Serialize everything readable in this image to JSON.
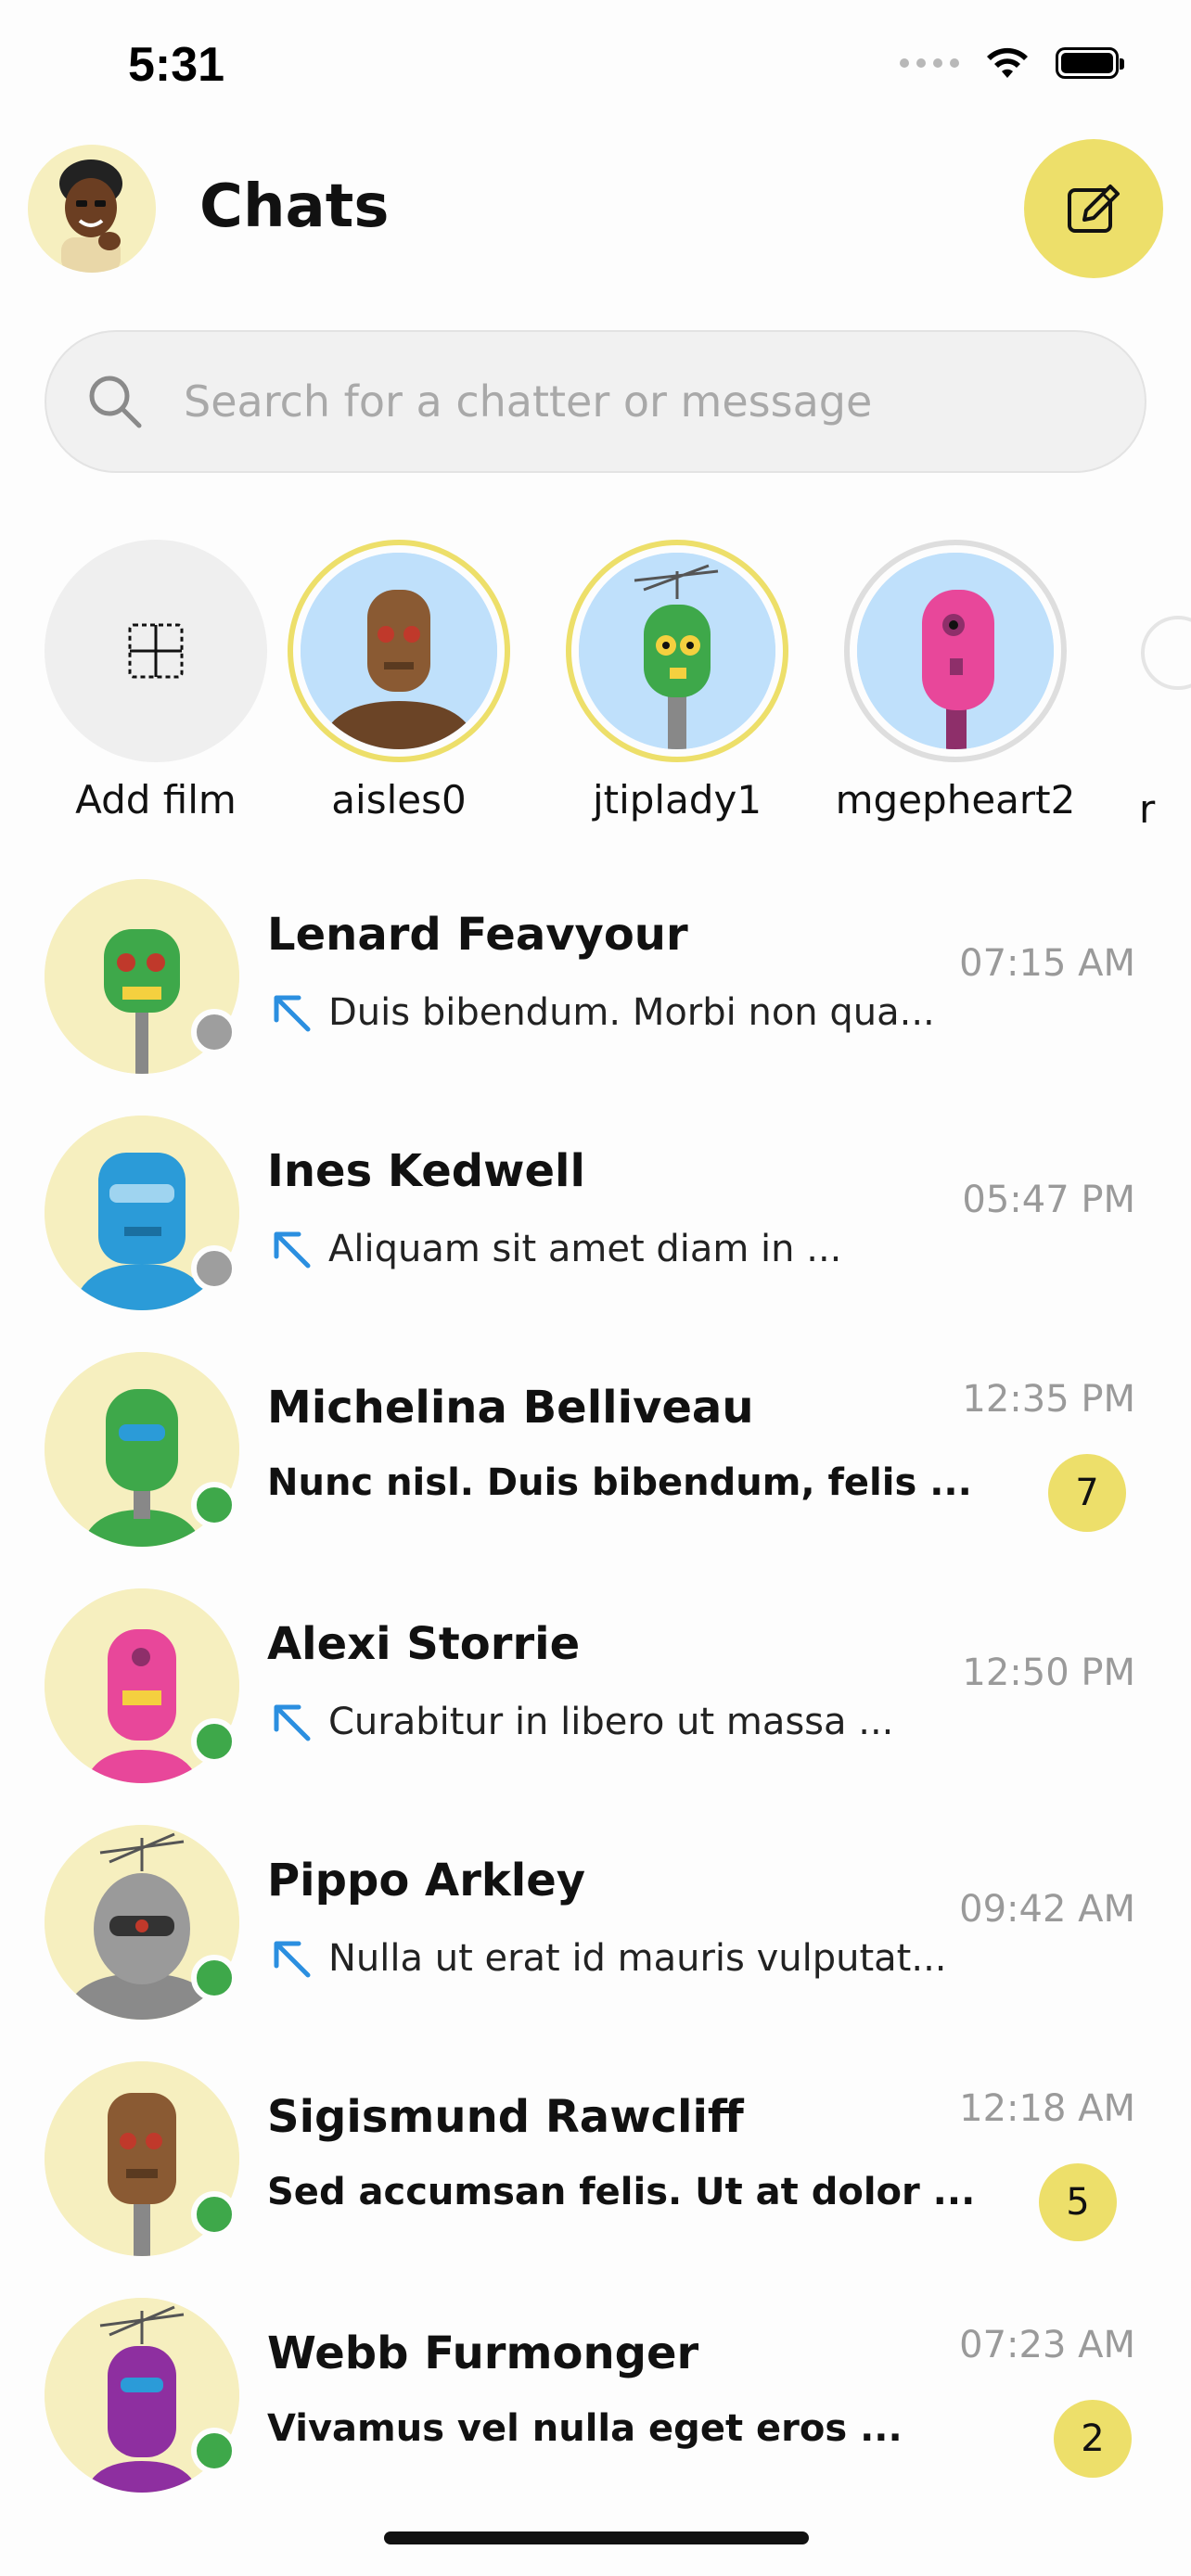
{
  "status_bar": {
    "time": "5:31"
  },
  "header": {
    "title": "Chats",
    "compose_icon": "compose-icon"
  },
  "search": {
    "placeholder": "Search for a chatter or message",
    "icon": "search-icon"
  },
  "films": [
    {
      "label": "Add film",
      "ring": "none",
      "icon": "add-film-icon"
    },
    {
      "label": "aisles0",
      "ring": "yellow",
      "robot_color": "#8a5a33"
    },
    {
      "label": "jtiplady1",
      "ring": "yellow",
      "robot_color": "#3ea84a"
    },
    {
      "label": "mgepheart2",
      "ring": "grey",
      "robot_color": "#e8479a"
    }
  ],
  "chats": [
    {
      "name": "Lenard Feavyour",
      "preview": "Duis bibendum. Morbi non qua...",
      "time": "07:15 AM",
      "status": "offline",
      "replied": true,
      "unread": "",
      "robot_color": "#3ea84a"
    },
    {
      "name": "Ines Kedwell",
      "preview": "Aliquam sit amet diam in ...",
      "time": "05:47 PM",
      "status": "offline",
      "replied": true,
      "unread": "",
      "robot_color": "#2b9bd8"
    },
    {
      "name": "Michelina Belliveau",
      "preview": "Nunc nisl. Duis bibendum, felis ...",
      "time": "12:35 PM",
      "status": "online",
      "replied": false,
      "unread": "7",
      "robot_color": "#3ea84a"
    },
    {
      "name": "Alexi Storrie",
      "preview": "Curabitur in libero ut massa ...",
      "time": "12:50 PM",
      "status": "online",
      "replied": true,
      "unread": "",
      "robot_color": "#e8479a"
    },
    {
      "name": "Pippo Arkley",
      "preview": "Nulla ut erat id mauris vulputat...",
      "time": "09:42 AM",
      "status": "online",
      "replied": true,
      "unread": "",
      "robot_color": "#9a9a9a"
    },
    {
      "name": "Sigismund Rawcliff",
      "preview": "Sed accumsan felis. Ut at dolor ...",
      "time": "12:18 AM",
      "status": "online",
      "replied": false,
      "unread": "5",
      "robot_color": "#8a5a33"
    },
    {
      "name": "Webb Furmonger",
      "preview": "Vivamus vel nulla eget eros ...",
      "time": "07:23 AM",
      "status": "online",
      "replied": false,
      "unread": "2",
      "robot_color": "#8e2fa0"
    }
  ],
  "colors": {
    "accent": "#eddf6a",
    "online": "#3ea84a",
    "offline": "#9e9e9e",
    "reply_arrow": "#2b8fe0"
  }
}
